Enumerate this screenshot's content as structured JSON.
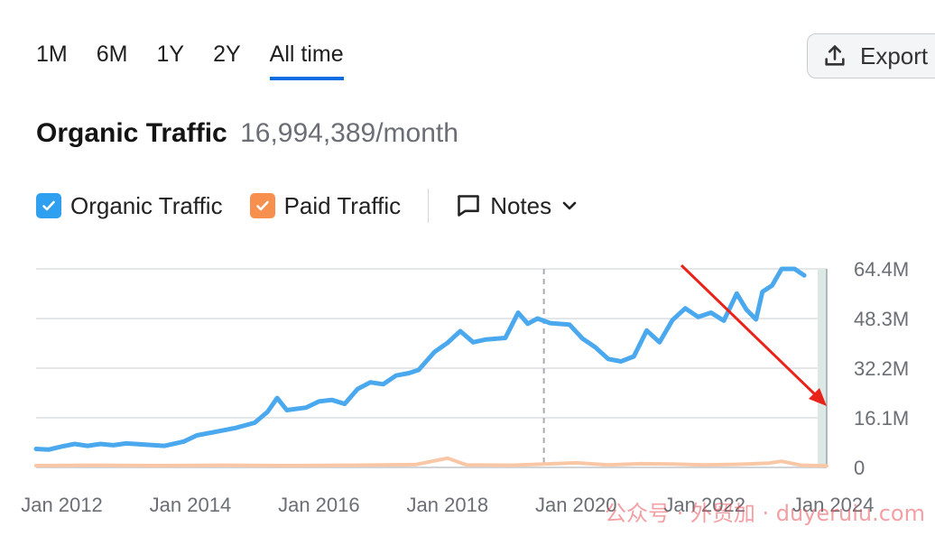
{
  "tabs": [
    {
      "label": "1M",
      "active": false
    },
    {
      "label": "6M",
      "active": false
    },
    {
      "label": "1Y",
      "active": false
    },
    {
      "label": "2Y",
      "active": false
    },
    {
      "label": "All time",
      "active": true
    }
  ],
  "export_label": "Export",
  "headline": {
    "title": "Organic Traffic",
    "value": "16,994,389/month"
  },
  "legend": {
    "organic_label": "Organic Traffic",
    "paid_label": "Paid Traffic",
    "notes_label": "Notes"
  },
  "watermark": "公众号 · 外贸加 · duyeruiu.com",
  "colors": {
    "organic": "#4aa8ee",
    "paid": "#f9c7a6",
    "organic_checkbox": "#2f9ff0",
    "paid_checkbox": "#f7904f",
    "accent": "#0b6ee0",
    "arrow": "#e8231a"
  },
  "chart_data": {
    "type": "line",
    "title": "",
    "xlabel": "",
    "ylabel": "",
    "x_tick_labels": [
      "Jan 2012",
      "Jan 2014",
      "Jan 2016",
      "Jan 2018",
      "Jan 2020",
      "Jan 2022",
      "Jan 2024"
    ],
    "x_tick_years": [
      2012,
      2014,
      2016,
      2018,
      2020,
      2022,
      2024
    ],
    "y_tick_labels": [
      "0",
      "16.1M",
      "32.2M",
      "48.3M",
      "64.4M"
    ],
    "ylim": [
      0,
      64.4
    ],
    "y_unit": "M",
    "xlim": [
      2011.6,
      2023.9
    ],
    "grid": true,
    "marker_line_year": 2019.5,
    "series": [
      {
        "name": "Organic Traffic",
        "color": "#4aa8ee",
        "points": [
          [
            2011.6,
            6.0
          ],
          [
            2011.8,
            5.8
          ],
          [
            2012.0,
            6.8
          ],
          [
            2012.2,
            7.6
          ],
          [
            2012.4,
            7.0
          ],
          [
            2012.6,
            7.6
          ],
          [
            2012.8,
            7.2
          ],
          [
            2013.0,
            7.8
          ],
          [
            2013.3,
            7.4
          ],
          [
            2013.6,
            7.0
          ],
          [
            2013.9,
            8.4
          ],
          [
            2014.1,
            10.4
          ],
          [
            2014.4,
            11.6
          ],
          [
            2014.7,
            12.8
          ],
          [
            2015.0,
            14.5
          ],
          [
            2015.2,
            18.0
          ],
          [
            2015.35,
            22.5
          ],
          [
            2015.5,
            18.6
          ],
          [
            2015.8,
            19.4
          ],
          [
            2016.0,
            21.4
          ],
          [
            2016.2,
            21.9
          ],
          [
            2016.4,
            20.6
          ],
          [
            2016.6,
            25.4
          ],
          [
            2016.8,
            27.6
          ],
          [
            2017.0,
            27.0
          ],
          [
            2017.2,
            29.8
          ],
          [
            2017.4,
            30.6
          ],
          [
            2017.55,
            31.6
          ],
          [
            2017.8,
            37.5
          ],
          [
            2018.0,
            40.4
          ],
          [
            2018.2,
            44.2
          ],
          [
            2018.4,
            40.6
          ],
          [
            2018.6,
            41.5
          ],
          [
            2018.9,
            42.0
          ],
          [
            2019.1,
            50.2
          ],
          [
            2019.25,
            46.6
          ],
          [
            2019.4,
            48.3
          ],
          [
            2019.6,
            46.8
          ],
          [
            2019.9,
            46.3
          ],
          [
            2020.1,
            41.8
          ],
          [
            2020.3,
            39.0
          ],
          [
            2020.5,
            35.2
          ],
          [
            2020.7,
            34.4
          ],
          [
            2020.9,
            36.0
          ],
          [
            2021.1,
            44.4
          ],
          [
            2021.3,
            40.6
          ],
          [
            2021.5,
            47.8
          ],
          [
            2021.7,
            51.6
          ],
          [
            2021.9,
            48.8
          ],
          [
            2022.1,
            50.2
          ],
          [
            2022.3,
            47.6
          ],
          [
            2022.5,
            56.4
          ],
          [
            2022.65,
            51.2
          ],
          [
            2022.8,
            48.0
          ],
          [
            2022.9,
            57.0
          ],
          [
            2023.05,
            59.0
          ],
          [
            2023.2,
            64.4
          ],
          [
            2023.4,
            64.4
          ],
          [
            2023.55,
            62.3
          ]
        ]
      },
      {
        "name": "Paid Traffic",
        "color": "#f9c7a6",
        "points": [
          [
            2011.6,
            0.6
          ],
          [
            2012.5,
            0.7
          ],
          [
            2013.5,
            0.6
          ],
          [
            2014.5,
            0.7
          ],
          [
            2015.5,
            0.6
          ],
          [
            2016.5,
            0.7
          ],
          [
            2017.5,
            0.9
          ],
          [
            2018.0,
            3.0
          ],
          [
            2018.3,
            0.8
          ],
          [
            2019.0,
            0.7
          ],
          [
            2020.0,
            1.5
          ],
          [
            2020.5,
            0.8
          ],
          [
            2021.0,
            1.2
          ],
          [
            2021.5,
            1.1
          ],
          [
            2022.0,
            0.8
          ],
          [
            2022.5,
            1.0
          ],
          [
            2023.0,
            1.4
          ],
          [
            2023.2,
            2.0
          ],
          [
            2023.5,
            0.7
          ],
          [
            2023.9,
            0.5
          ]
        ]
      }
    ]
  }
}
